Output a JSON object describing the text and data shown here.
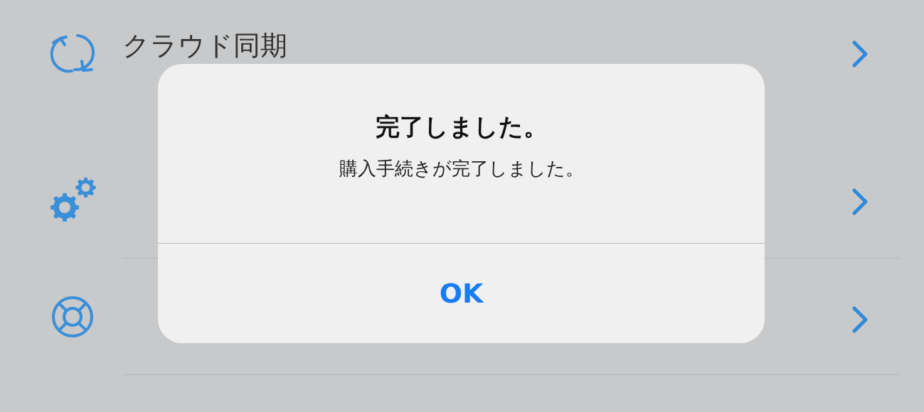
{
  "settings_rows": [
    {
      "kind": "sync",
      "label": "クラウド同期"
    },
    {
      "kind": "settings"
    },
    {
      "kind": "support"
    }
  ],
  "alert": {
    "title": "完了しました。",
    "message": "購入手続きが完了しました。",
    "buttons": [
      "OK"
    ]
  }
}
